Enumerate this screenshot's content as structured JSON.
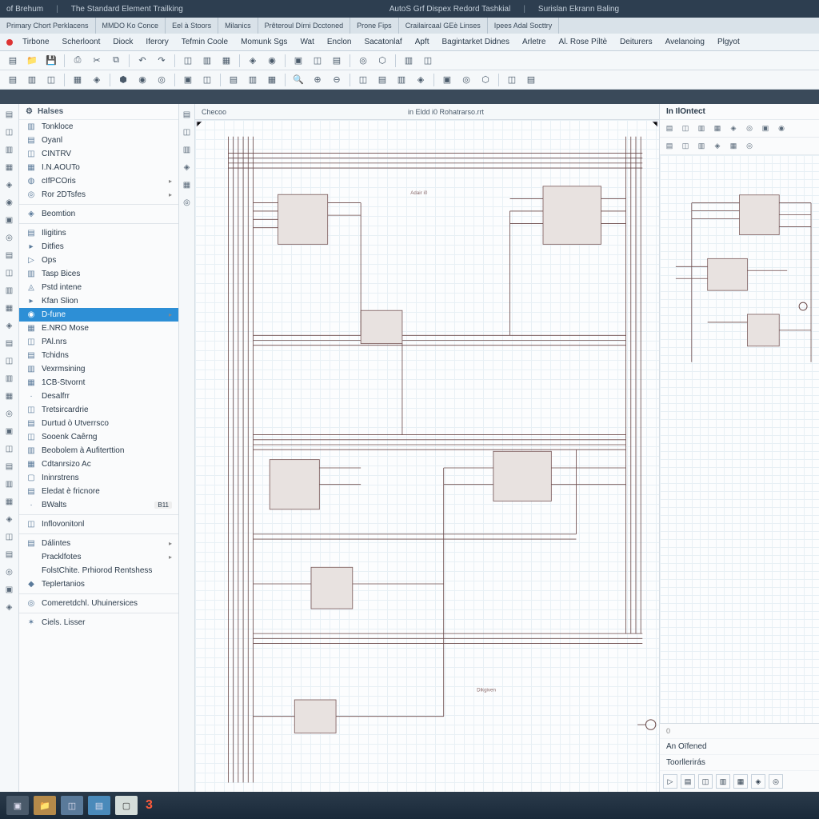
{
  "titlebar": {
    "left1": "of Brehum",
    "left2": "The Standard Element Trailking",
    "center1": "AutoS Grf Dispex Redord Tashkial",
    "center2": "Surislan Ekrann Baling"
  },
  "tabbar": {
    "tabs": [
      "Primary Chort Perklacens",
      "MMDO Ko Conce",
      "Eel à Stoors",
      "Milanics",
      "Prêteroul Dírni Dcctoned",
      "Prone Fips",
      "Crailaircaal GEè Linses",
      "Ipees Adal Socttry"
    ]
  },
  "menubar": {
    "items": [
      "Tirbone",
      "Scherloont",
      "Diock",
      "Iferory",
      "Tefmin Coole",
      "Momunk Sgs",
      "Wat",
      "Enclon",
      "Sacatonlaf",
      "Apft",
      "Bagintarket Didnes",
      "Arletre",
      "Al. Rose Píltè",
      "Deiturers",
      "Avelanoing",
      "Plgyot"
    ]
  },
  "left": {
    "header": "Halses",
    "g1": [
      {
        "label": "Tonkloce",
        "ico": "▥"
      },
      {
        "label": "Oyanl",
        "ico": "▤"
      },
      {
        "label": "CINTRV",
        "ico": "◫"
      },
      {
        "label": "I.N.AOUTo",
        "ico": "▦"
      },
      {
        "label": "cIfPCOris",
        "ico": "◍",
        "arrow": true
      },
      {
        "label": "Ror 2DTsfes",
        "ico": "◎",
        "arrow": true
      }
    ],
    "g2": [
      {
        "label": "Beomtion",
        "ico": "◈"
      }
    ],
    "g3": [
      {
        "label": "Iligitins",
        "ico": "▤"
      },
      {
        "label": "Ditfies",
        "ico": "▸"
      },
      {
        "label": "Ops",
        "ico": "▷"
      },
      {
        "label": "Tasp Bices",
        "ico": "▥"
      },
      {
        "label": "Pstd intene",
        "ico": "◬"
      },
      {
        "label": "Kfan Slion",
        "ico": "▸"
      },
      {
        "label": "D-fune",
        "ico": "◉",
        "active": true,
        "arrow": true
      },
      {
        "label": "E.NRO Mose",
        "ico": "▦"
      },
      {
        "label": "PAl.nrs",
        "ico": "◫"
      },
      {
        "label": "Tchidns",
        "ico": "▤"
      },
      {
        "label": "Vexrmsining",
        "ico": "▥"
      },
      {
        "label": "1CB-Stvornt",
        "ico": "▦"
      },
      {
        "label": "Desalfrr",
        "ico": "·"
      },
      {
        "label": "Tretsircardrie",
        "ico": "◫"
      },
      {
        "label": "Durtud ò Utverrsco",
        "ico": "▤"
      },
      {
        "label": "Sooenk Caêrng",
        "ico": "◫"
      },
      {
        "label": "Beobolem à Aufiterttion",
        "ico": "▥"
      },
      {
        "label": "Cdtanrsizo Ac",
        "ico": "▦"
      },
      {
        "label": "Ininrstrens",
        "ico": "▢"
      },
      {
        "label": "Eledat è fricnore",
        "ico": "▤"
      },
      {
        "label": "BWalts",
        "ico": "·",
        "badge": "B11"
      }
    ],
    "g4": [
      {
        "label": "Inflovonitonl",
        "ico": "◫"
      }
    ],
    "g5": [
      {
        "label": "Dálintes",
        "ico": "▤",
        "arrow": true
      },
      {
        "label": "Pracklfotes",
        "ico": " ",
        "arrow": true
      },
      {
        "label": "FolstChite. Prhiorod Rentshess",
        "ico": " "
      },
      {
        "label": "Teplertanios",
        "ico": "◆"
      }
    ],
    "g6": [
      {
        "label": "Comeretdchl. Uhuinersices",
        "ico": "◎"
      }
    ],
    "g7": [
      {
        "label": "Ciels. Lisser",
        "ico": "✶"
      }
    ]
  },
  "canvas": {
    "tab1": "Checoo",
    "tab2": "in Eldd i0 Rohatrarso.rrt",
    "label1": "Adair i0",
    "label2": "Dikgiven"
  },
  "right": {
    "header": "In IlOntect",
    "sec1": "An Oïfened",
    "sec2": "Toorllerirás"
  },
  "taskbar": {
    "badge": "3"
  }
}
